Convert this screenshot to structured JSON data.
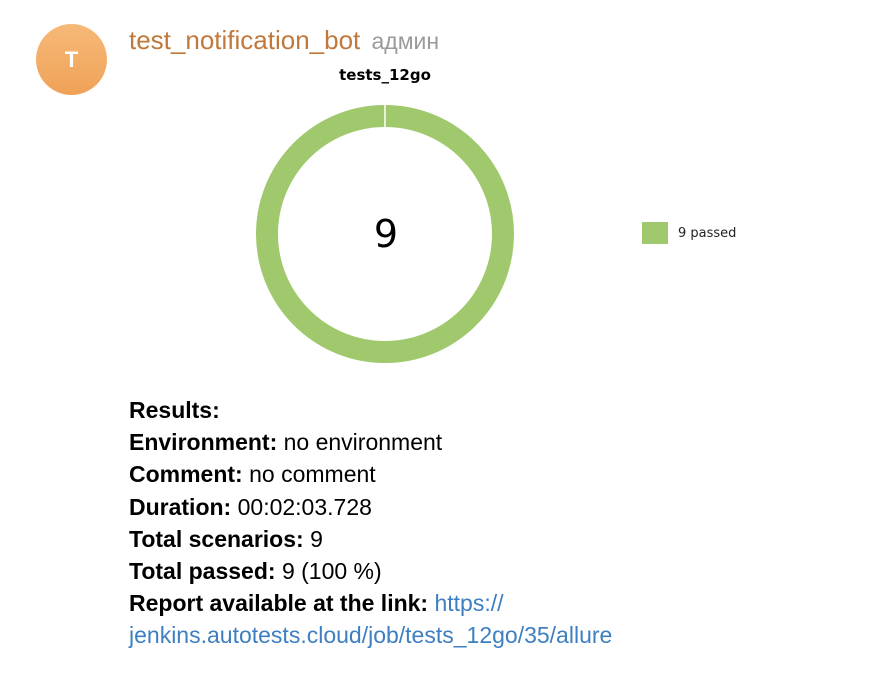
{
  "message": {
    "avatar_letter": "T",
    "avatar_color": "#f0a257",
    "sender": "test_notification_bot",
    "role": "админ"
  },
  "chart_data": {
    "type": "pie",
    "style": "donut",
    "title": "tests_12go",
    "center_label": "9",
    "slices": [
      {
        "name": "9 passed",
        "value": 9,
        "color": "#9fc96c"
      }
    ],
    "legend_position": "right"
  },
  "results": {
    "heading": "Results:",
    "environment_label": "Environment:",
    "environment_value": "no environment",
    "comment_label": "Comment:",
    "comment_value": "no comment",
    "duration_label": "Duration:",
    "duration_value": "00:02:03.728",
    "total_scenarios_label": "Total scenarios:",
    "total_scenarios_value": "9",
    "total_passed_label": "Total passed:",
    "total_passed_value": "9 (100 %)",
    "report_label": "Report available at the link:",
    "report_link_part1": "https://",
    "report_link_part2": "jenkins.autotests.cloud/job/tests_12go/35/allure"
  }
}
